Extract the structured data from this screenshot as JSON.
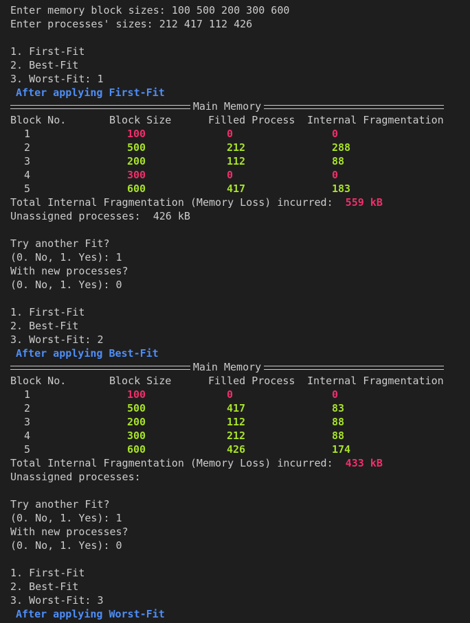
{
  "input": {
    "memory_prompt": "Enter memory block sizes: 100 500 200 300 600",
    "process_prompt": "Enter processes' sizes: 212 417 112 426"
  },
  "menu": {
    "opt1": "1. First-Fit",
    "opt2": "2. Best-Fit",
    "opt3_prefix": "3. Worst-Fit: "
  },
  "table_headers": {
    "banner_title": "Main Memory",
    "block_no": "Block No.",
    "block_size": "Block Size",
    "filled_process": "Filled Process",
    "internal_frag": "Internal Fragmentation"
  },
  "runs": [
    {
      "choice": "1",
      "after_label": "After applying First-Fit",
      "rows": [
        {
          "block_no": "1",
          "block_size": "100",
          "filled": "0",
          "frag": "0",
          "used": false
        },
        {
          "block_no": "2",
          "block_size": "500",
          "filled": "212",
          "frag": "288",
          "used": true
        },
        {
          "block_no": "3",
          "block_size": "200",
          "filled": "112",
          "frag": "88",
          "used": true
        },
        {
          "block_no": "4",
          "block_size": "300",
          "filled": "0",
          "frag": "0",
          "used": false
        },
        {
          "block_no": "5",
          "block_size": "600",
          "filled": "417",
          "frag": "183",
          "used": true
        }
      ],
      "total_label": "Total Internal Fragmentation (Memory Loss) incurred:  ",
      "total_value": "559 kB",
      "unassigned": "Unassigned processes:  426 kB",
      "try_another": "Try another Fit?",
      "try_answer": "(0. No, 1. Yes): 1",
      "new_procs": "With new processes?",
      "new_answer": "(0. No, 1. Yes): 0"
    },
    {
      "choice": "2",
      "after_label": "After applying Best-Fit",
      "rows": [
        {
          "block_no": "1",
          "block_size": "100",
          "filled": "0",
          "frag": "0",
          "used": false
        },
        {
          "block_no": "2",
          "block_size": "500",
          "filled": "417",
          "frag": "83",
          "used": true
        },
        {
          "block_no": "3",
          "block_size": "200",
          "filled": "112",
          "frag": "88",
          "used": true
        },
        {
          "block_no": "4",
          "block_size": "300",
          "filled": "212",
          "frag": "88",
          "used": true
        },
        {
          "block_no": "5",
          "block_size": "600",
          "filled": "426",
          "frag": "174",
          "used": true
        }
      ],
      "total_label": "Total Internal Fragmentation (Memory Loss) incurred:  ",
      "total_value": "433 kB",
      "unassigned": "Unassigned processes: ",
      "try_another": "Try another Fit?",
      "try_answer": "(0. No, 1. Yes): 1",
      "new_procs": "With new processes?",
      "new_answer": "(0. No, 1. Yes): 0"
    },
    {
      "choice": "3",
      "after_label": "After applying Worst-Fit"
    }
  ],
  "colors": {
    "background": "#1e1e1e",
    "text": "#cccccc",
    "accent_blue": "#4e8ef7",
    "unused_red": "#ef2f6b",
    "used_green": "#a8e22a"
  }
}
